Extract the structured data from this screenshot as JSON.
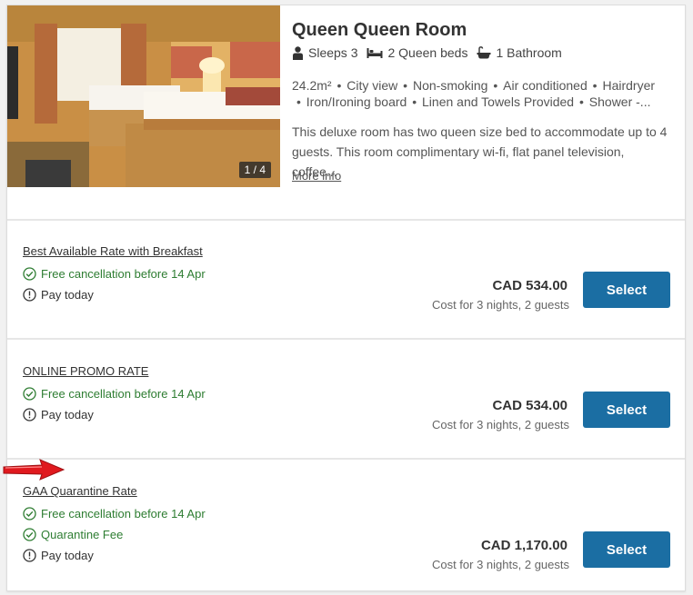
{
  "room": {
    "photo_counter": "1 / 4",
    "title": "Queen Queen Room",
    "sleeps": "Sleeps 3",
    "beds": "2 Queen beds",
    "bathroom": "1 Bathroom",
    "amenities_line1": [
      "24.2m²",
      "City view",
      "Non-smoking",
      "Air conditioned",
      "Hairdryer"
    ],
    "amenities_line2": [
      "Iron/Ironing board",
      "Linen and Towels Provided",
      "Shower -..."
    ],
    "description": "This deluxe room has two queen size bed to accommodate up to 4 guests. This room complimentary wi-fi, flat panel television, coffee...",
    "more_info": "More info"
  },
  "rates": [
    {
      "name": "Best Available Rate with Breakfast",
      "cancellation": "Free cancellation before 14 Apr",
      "payment": "Pay today",
      "price": "CAD 534.00",
      "cost_note": "Cost for 3 nights, 2 guests",
      "button": "Select"
    },
    {
      "name": "ONLINE PROMO RATE",
      "cancellation": "Free cancellation before 14 Apr",
      "payment": "Pay today",
      "price": "CAD 534.00",
      "cost_note": "Cost for 3 nights, 2 guests",
      "button": "Select"
    },
    {
      "name": "GAA Quarantine Rate",
      "cancellation": "Free cancellation before 14 Apr",
      "extra": "Quarantine Fee",
      "payment": "Pay today",
      "price": "CAD 1,170.00",
      "cost_note": "Cost for 3 nights, 2 guests",
      "button": "Select"
    }
  ],
  "colors": {
    "button": "#1b6ea3",
    "green": "#2e7d32",
    "annotation_arrow": "#e0191e"
  }
}
